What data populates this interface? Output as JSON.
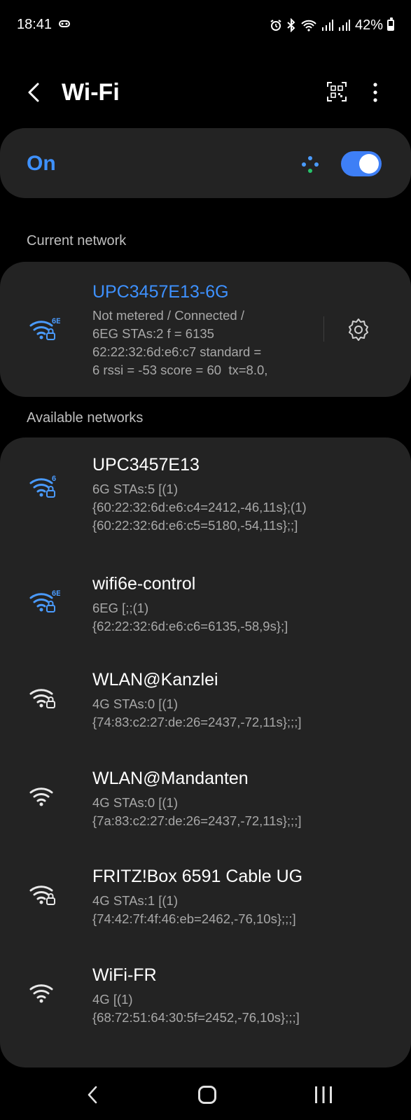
{
  "status_bar": {
    "time": "18:41",
    "battery": "42%",
    "battery_level": 0.42
  },
  "header": {
    "title": "Wi-Fi"
  },
  "wifi_toggle": {
    "label": "On",
    "state": true,
    "accent_color": "#3e7ff6"
  },
  "current_section": {
    "title": "Current network",
    "network": {
      "name": "UPC3457E13-6G",
      "band": "6E",
      "secured": true,
      "details": "Not metered / Connected /\n6EG STAs:2 f = 6135\n62:22:32:6d:e6:c7 standard =\n6 rssi = -53 score = 60  tx=8.0,"
    }
  },
  "available_section": {
    "title": "Available networks",
    "networks": [
      {
        "name": "UPC3457E13",
        "band": "6",
        "secured": true,
        "icon_color": "#4a9bff",
        "details": "6G STAs:5 [(1)\n{60:22:32:6d:e6:c4=2412,-46,11s};(1)\n{60:22:32:6d:e6:c5=5180,-54,11s};;]"
      },
      {
        "name": "wifi6e-control",
        "band": "6E",
        "secured": true,
        "icon_color": "#4a9bff",
        "details": "6EG [;;(1)\n{62:22:32:6d:e6:c6=6135,-58,9s};]"
      },
      {
        "name": "WLAN@Kanzlei",
        "band": "",
        "secured": true,
        "icon_color": "#e8e8e8",
        "details": "4G STAs:0 [(1)\n{74:83:c2:27:de:26=2437,-72,11s};;;]"
      },
      {
        "name": "WLAN@Mandanten",
        "band": "",
        "secured": false,
        "icon_color": "#e8e8e8",
        "details": "4G STAs:0 [(1)\n{7a:83:c2:27:de:26=2437,-72,11s};;;]"
      },
      {
        "name": "FRITZ!Box 6591 Cable UG",
        "band": "",
        "secured": true,
        "icon_color": "#e8e8e8",
        "details": "4G STAs:1 [(1)\n{74:42:7f:4f:46:eb=2462,-76,10s};;;]"
      },
      {
        "name": "WiFi-FR",
        "band": "",
        "secured": false,
        "icon_color": "#e8e8e8",
        "details": "4G [(1)\n{68:72:51:64:30:5f=2452,-76,10s};;;]"
      }
    ]
  }
}
